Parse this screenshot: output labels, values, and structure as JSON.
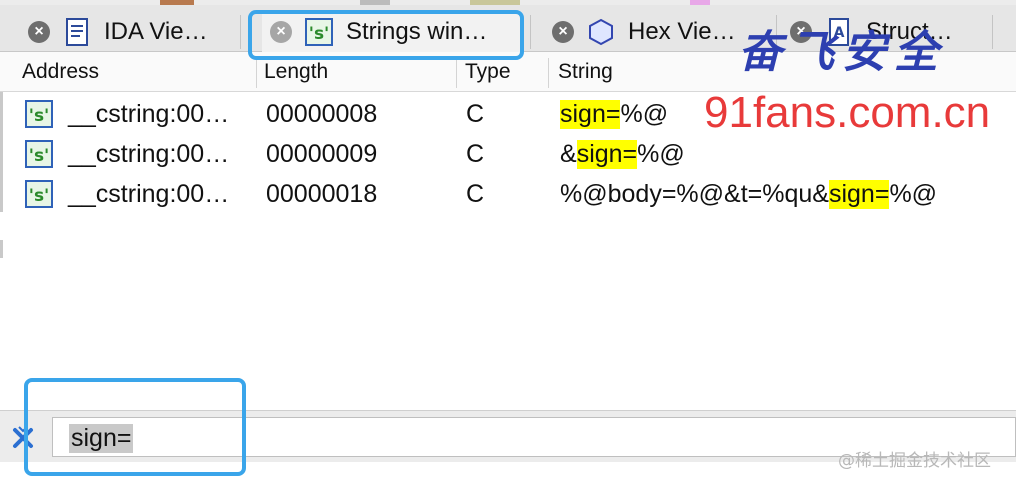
{
  "colors": {
    "highlight": "#ffff00",
    "callout_blue": "#3aa5ea",
    "watermark_blue": "#2d3fb0",
    "watermark_red": "#e83a3a"
  },
  "tabs": [
    {
      "label": "IDA Vie…",
      "icon": "ida-view-icon",
      "active": false
    },
    {
      "label": "Strings win…",
      "icon": "strings-icon",
      "active": true
    },
    {
      "label": "Hex Vie…",
      "icon": "hex-view-icon",
      "active": false
    },
    {
      "label": "Struct…",
      "icon": "structures-icon",
      "active": false
    }
  ],
  "columns": {
    "address": "Address",
    "length": "Length",
    "type": "Type",
    "string": "String"
  },
  "rows": [
    {
      "address": "__cstring:00…",
      "length": "00000008",
      "type": "C",
      "string_pre": "",
      "string_hl": "sign=",
      "string_post": "%@"
    },
    {
      "address": "__cstring:00…",
      "length": "00000009",
      "type": "C",
      "string_pre": "&",
      "string_hl": "sign=",
      "string_post": "%@"
    },
    {
      "address": "__cstring:00…",
      "length": "00000018",
      "type": "C",
      "string_pre": "%@body=%@&t=%qu&",
      "string_hl": "sign=",
      "string_post": "%@"
    }
  ],
  "filter": {
    "value": "sign=",
    "icon": "filter-close-icon"
  },
  "watermarks": {
    "cn_text": "奋飞安全",
    "url_text": "91fans.com.cn",
    "juejin_text": "@稀土掘金技术社区"
  }
}
